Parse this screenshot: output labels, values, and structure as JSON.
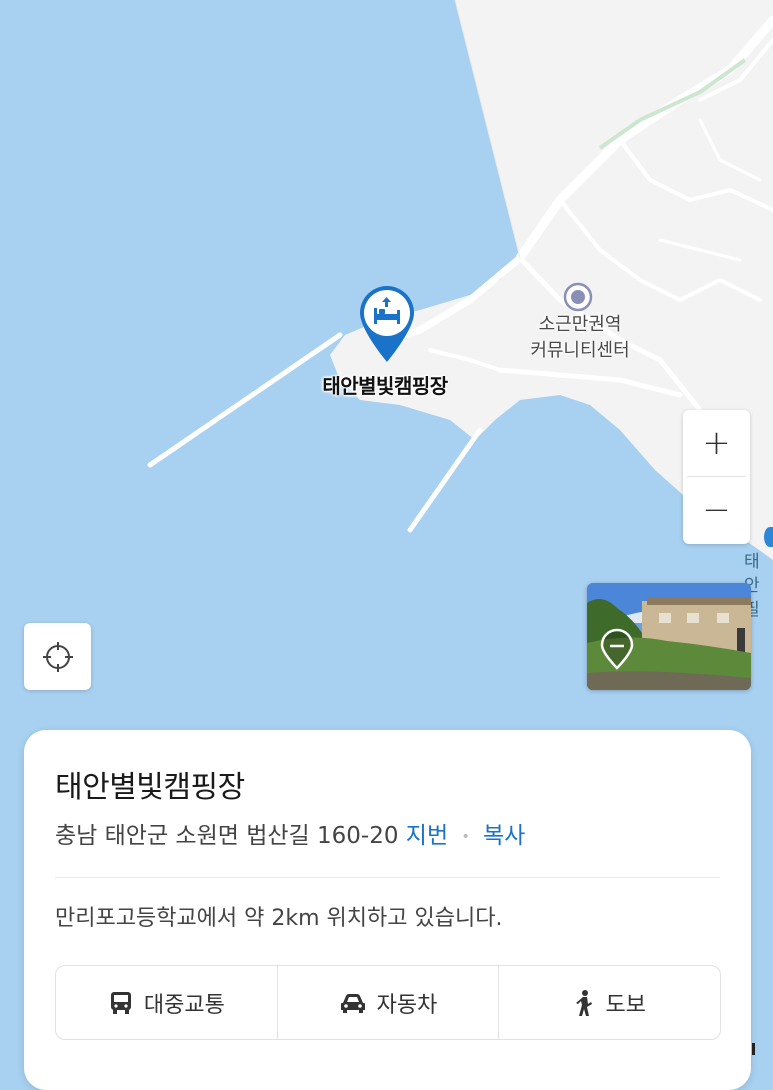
{
  "map": {
    "colors": {
      "water": "#a8d0f0",
      "land": "#f2f2f2",
      "road": "#ffffff",
      "accent": "#1a73c8"
    },
    "place_marker": {
      "icon": "lodging-bed-icon",
      "label": "태안별빛캠핑장"
    },
    "poi": {
      "icon": "community-center-icon",
      "label_line1": "소근만권역",
      "label_line2": "커뮤니티센터"
    },
    "edge_label_line1": "태안",
    "edge_label_line2": "필",
    "zoom_in": "+",
    "zoom_out": "−",
    "locate_icon": "crosshair-icon",
    "street_view_icon": "street-view-icon"
  },
  "card": {
    "title": "태안별빛캠핑장",
    "address": "충남 태안군 소원면 법산길 160-20",
    "jibun_link": "지번",
    "separator": "•",
    "copy_link": "복사",
    "description": "만리포고등학교에서 약 2km 위치하고 있습니다.",
    "modes": [
      {
        "icon": "bus-icon",
        "label": "대중교통"
      },
      {
        "icon": "car-icon",
        "label": "자동차"
      },
      {
        "icon": "walk-icon",
        "label": "도보"
      }
    ]
  }
}
